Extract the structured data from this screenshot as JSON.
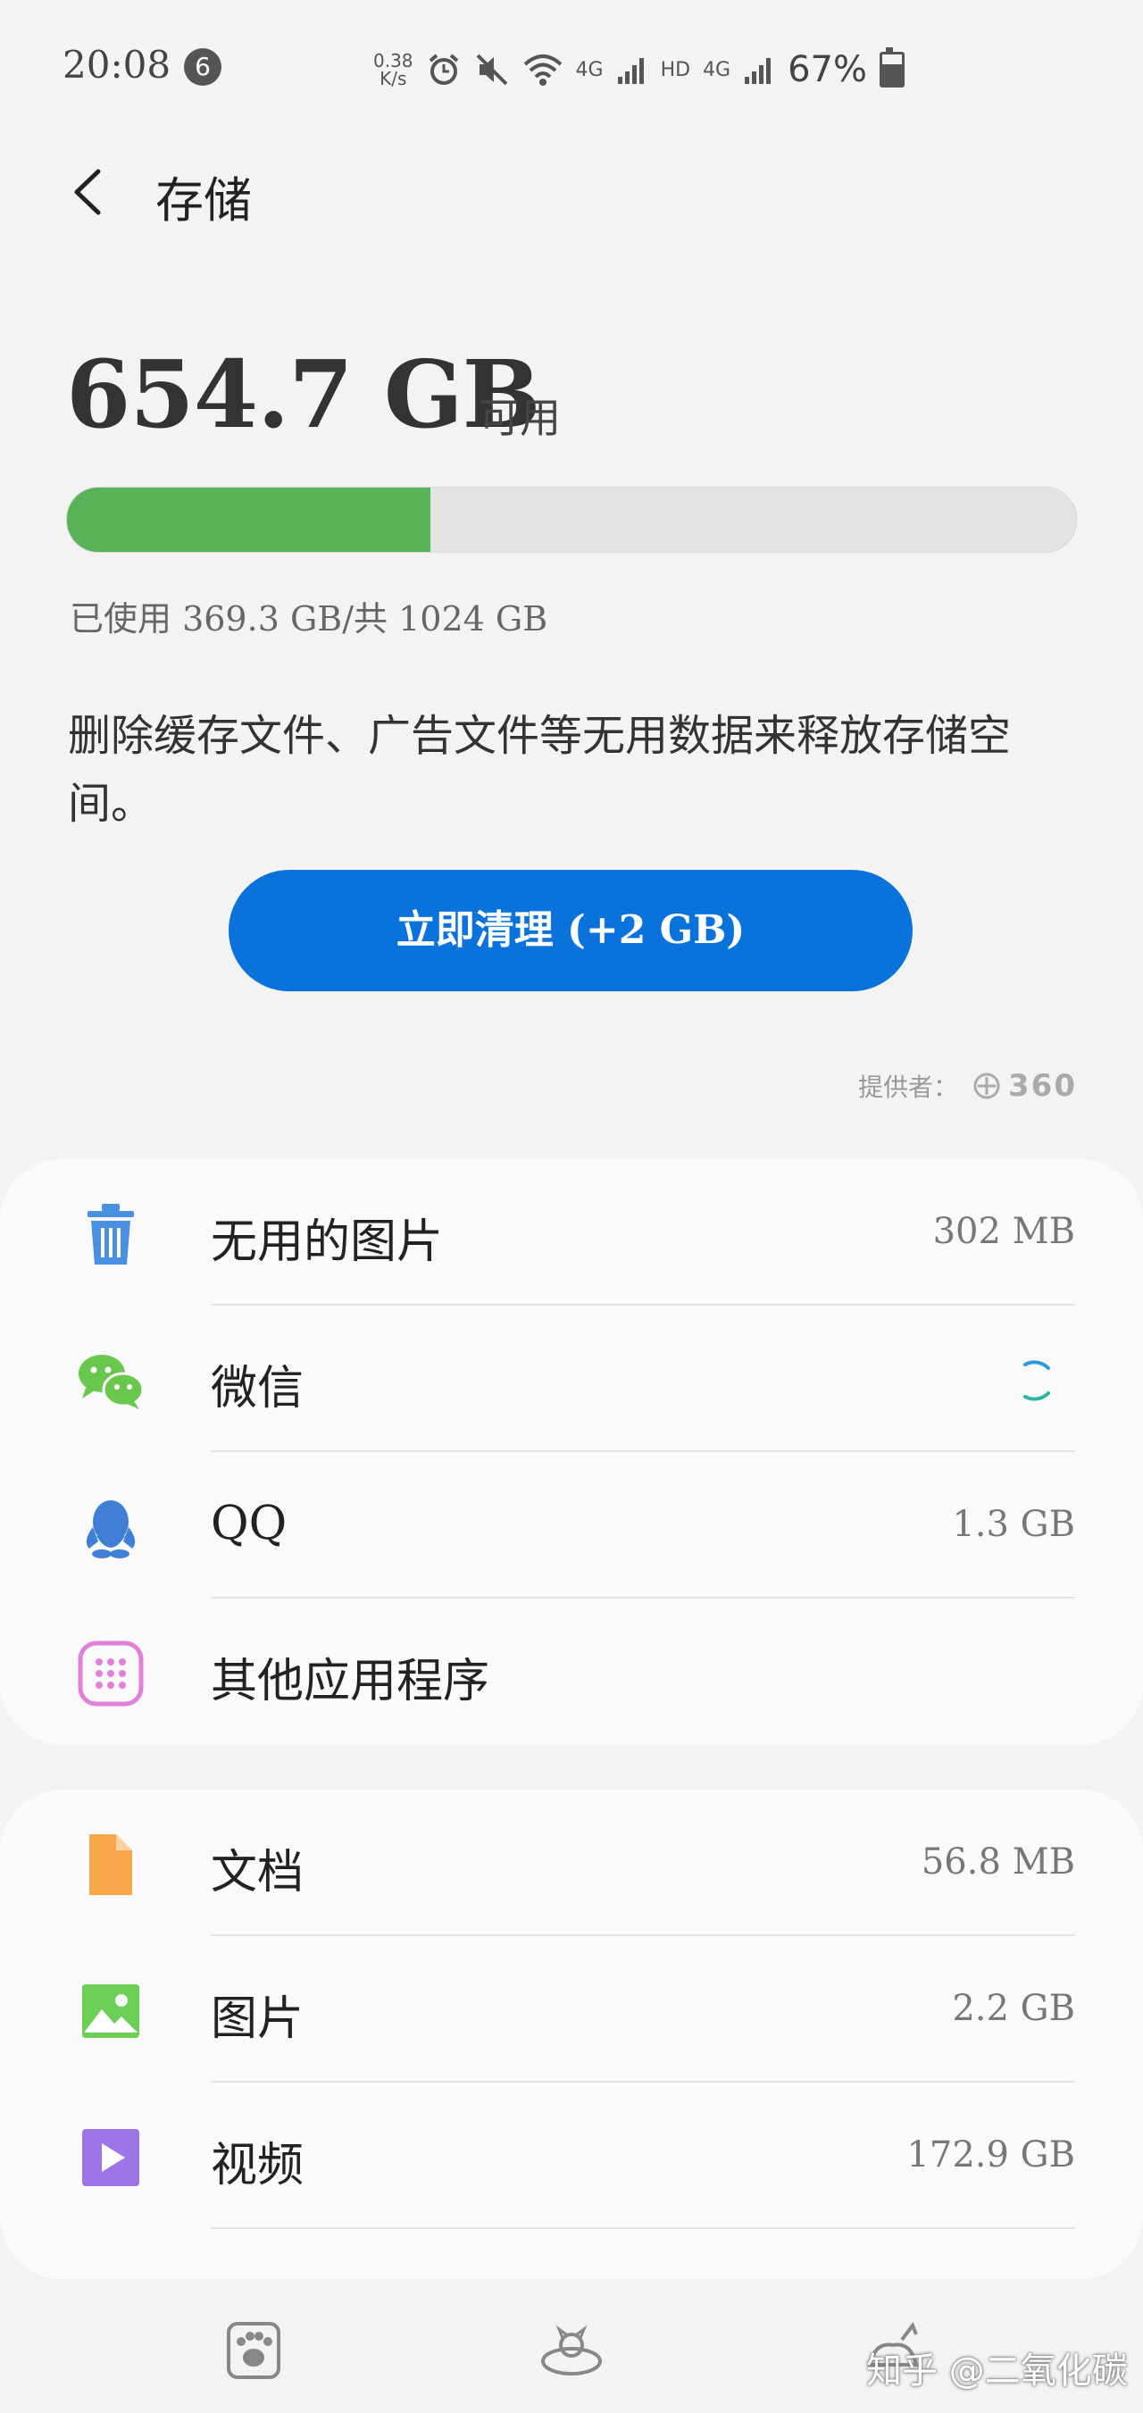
{
  "status_bar": {
    "time": "20:08",
    "notification_count": "6",
    "net_speed_value": "0.38",
    "net_speed_unit": "K/s",
    "network_label_1": "4G",
    "hd_label": "HD",
    "network_label_2": "4G",
    "battery_text": "67%",
    "battery_level": 0.67
  },
  "header": {
    "title": "存储"
  },
  "storage": {
    "available": "654.7 GB",
    "available_label": "可用",
    "used_fraction": 0.36,
    "used_text": "已使用 369.3 GB/共 1024 GB",
    "description": "删除缓存文件、广告文件等无用数据来释放存储空间。",
    "clean_button": "立即清理 (+2 GB)",
    "provider_label": "提供者：",
    "provider_name": "360"
  },
  "cleanup_items": [
    {
      "label": "无用的图片",
      "value": "302 MB",
      "icon": "trash-icon"
    },
    {
      "label": "微信",
      "value": "",
      "icon": "wechat-icon"
    },
    {
      "label": "QQ",
      "value": "1.3 GB",
      "icon": "qq-icon"
    },
    {
      "label": "其他应用程序",
      "value": "",
      "icon": "apps-grid-icon"
    }
  ],
  "file_items": [
    {
      "label": "文档",
      "value": "56.8 MB",
      "icon": "document-icon"
    },
    {
      "label": "图片",
      "value": "2.2 GB",
      "icon": "image-icon"
    },
    {
      "label": "视频",
      "value": "172.9 GB",
      "icon": "video-icon"
    }
  ],
  "watermark": "知乎 @二氧化碳",
  "colors": {
    "used_bar": "#58b257",
    "button": "#0a73db",
    "trash": "#4a90e2",
    "wechat": "#6ac74e",
    "qq": "#3f7fd6",
    "apps": "#e080d8",
    "document": "#f6a54a",
    "image": "#6ccf58",
    "video": "#9c74e6"
  }
}
